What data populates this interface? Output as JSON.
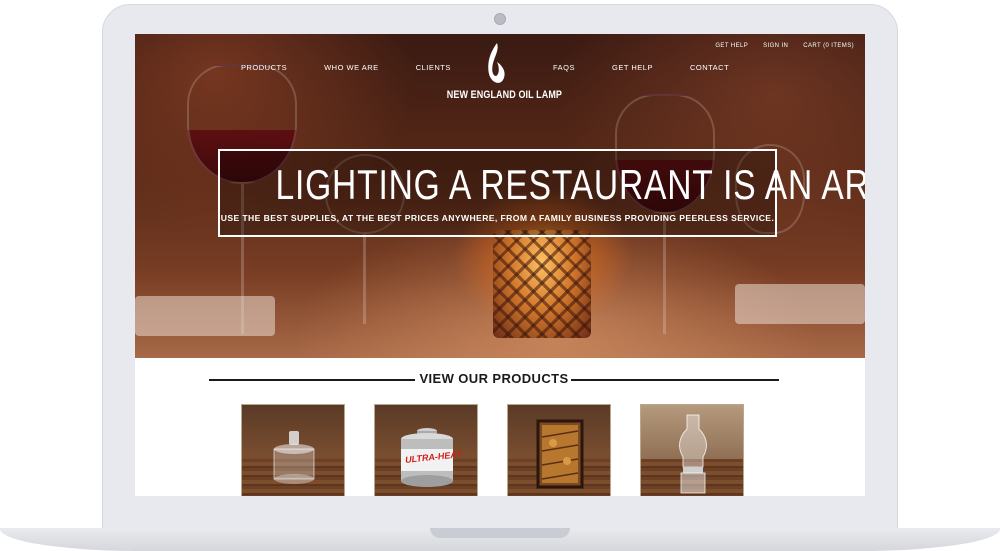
{
  "brand": {
    "name": "NEW ENGLAND OIL LAMP"
  },
  "utility_nav": [
    "GET HELP",
    "SIGN IN",
    "CART (0 ITEMS)"
  ],
  "main_nav_left": [
    "PRODUCTS",
    "WHO WE ARE",
    "CLIENTS"
  ],
  "main_nav_right": [
    "FAQS",
    "GET HELP",
    "CONTACT"
  ],
  "hero": {
    "headline": "LIGHTING A RESTAURANT IS AN ART",
    "subline": "USE THE BEST SUPPLIES, AT THE BEST PRICES ANYWHERE, FROM A FAMILY BUSINESS PROVIDING PEERLESS SERVICE."
  },
  "products_section": {
    "title": "VIEW OUR PRODUCTS",
    "products": [
      {
        "icon": "fuel-cell-icon"
      },
      {
        "icon": "chafing-fuel-can-icon",
        "label": "ULTRA-HEAT"
      },
      {
        "icon": "mosaic-candle-holder-icon"
      },
      {
        "icon": "glass-chimney-lamp-icon"
      }
    ]
  },
  "colors": {
    "accent": "#ffffff",
    "rule": "#1a1a1a",
    "hero_dark": "#3a1a12",
    "flame_glow": "#ffc060"
  }
}
